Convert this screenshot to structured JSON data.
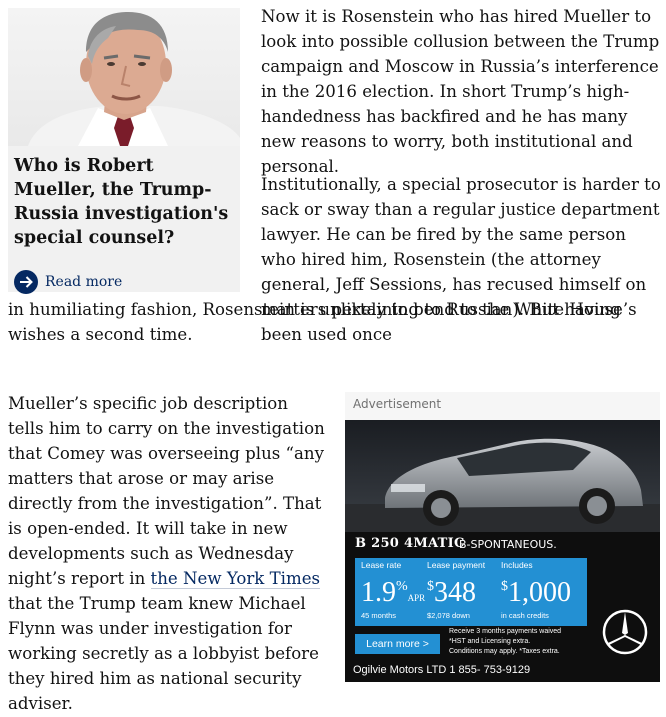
{
  "explainer": {
    "title": "Who is Robert Mueller, the Trump-Russia investigation's special counsel?",
    "read_more": "Read more"
  },
  "article": {
    "p1": "Now it is Rosenstein who has hired Mueller to look into possible collusion between the Trump campaign and Moscow in Russia’s interference in the 2016 election. In short Trump’s high-handedness has backfired and he has many new reasons to worry, both institutional and personal.",
    "p2_wrap": "Institutionally, a special prosecutor is harder to sack or sway than a regular justice department lawyer. He can be fired by the same person who hired him, Rosenstein (the attorney general, Jeff Sessions, has recused himself on matters pertaining to Russian). But having been used once",
    "p2_full": "in humiliating fashion, Rosenstein is unlikely to bend to the White House’s wishes a second time.",
    "p3_before": "Mueller’s specific job description tells him to carry on the investigation that Comey was overseeing plus “any matters that arose or may arise directly from the investigation”. That is open-ended. It will take in new developments such as Wednesday night’s report in ",
    "p3_link": "the New York Times",
    "p3_after": " that the Trump team knew Michael Flynn was under investigation for working secretly as a lobbyist before they hired him as national security adviser."
  },
  "ad": {
    "label": "Advertisement",
    "model": "B 250 4MATIC",
    "tagline": "B-SPONTANEOUS.",
    "lease_rate": {
      "header": "Lease rate",
      "value": "1.9",
      "sup": "%",
      "unit": "APR",
      "sub": "45 months"
    },
    "lease_payment": {
      "header": "Lease payment",
      "sup": "$",
      "value": "348",
      "sub": "$2,078 down"
    },
    "includes": {
      "header": "Includes",
      "sup": "$",
      "value": "1,000",
      "sub": "in cash credits"
    },
    "learn_more": "Learn more >",
    "fine1": "Receive 3 months payments waived",
    "fine2": "*HST and Licensing extra.",
    "fine3": "Conditions may apply. *Taxes extra.",
    "dealer": "Ogilvie Motors LTD 1 855- 753-9129"
  },
  "colors": {
    "link": "#052962",
    "offer_blue": "#2390d3",
    "card_bg": "#f1f1f1"
  }
}
